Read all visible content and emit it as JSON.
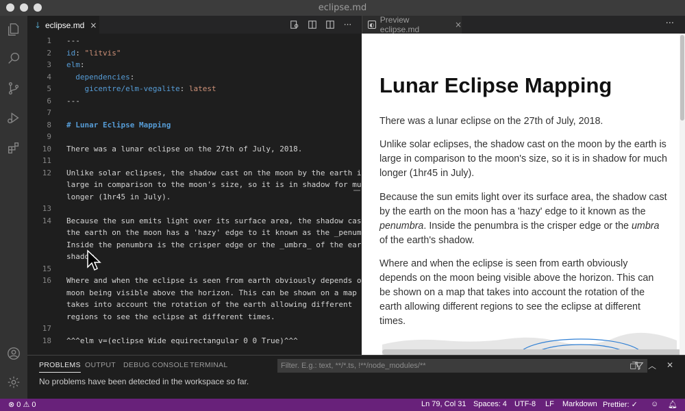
{
  "window": {
    "title": "eclipse.md"
  },
  "activity_bar": {
    "items": [
      "explorer-icon",
      "search-icon",
      "source-control-icon",
      "run-debug-icon",
      "extensions-icon"
    ],
    "bottom": [
      "account-icon",
      "settings-gear-icon"
    ]
  },
  "editor": {
    "tab_label": "eclipse.md",
    "tab_close": "×",
    "tab_icon": "↓",
    "lines": [
      {
        "n": "1",
        "text": "---"
      },
      {
        "n": "2",
        "key": "id",
        "sep": ": ",
        "value": "\"litvis\""
      },
      {
        "n": "3",
        "key": "elm",
        "sep": ":",
        "value": ""
      },
      {
        "n": "4",
        "indent": "  ",
        "key": "dependencies",
        "sep": ":",
        "value": ""
      },
      {
        "n": "5",
        "indent": "    ",
        "key": "gicentre/elm-vegalite",
        "sep": ": ",
        "value": "latest"
      },
      {
        "n": "6",
        "text": "---"
      },
      {
        "n": "7",
        "text": ""
      },
      {
        "n": "8",
        "heading": "# Lunar Eclipse Mapping"
      },
      {
        "n": "9",
        "text": ""
      },
      {
        "n": "10",
        "text": "There was a lunar eclipse on the 27th of July, 2018."
      },
      {
        "n": "11",
        "text": ""
      },
      {
        "n": "12",
        "text": "Unlike solar eclipses, the shadow cast on the moon by the earth is"
      },
      {
        "n": "",
        "text": "large in comparison to the moon's size, so it is in shadow for much"
      },
      {
        "n": "",
        "text": "longer (1hr45 in July)."
      },
      {
        "n": "13",
        "text": ""
      },
      {
        "n": "14",
        "text": "Because the sun emits light over its surface area, the shadow cast by"
      },
      {
        "n": "",
        "text": "the earth on the moon has a 'hazy' edge to it known as the _penumbra_."
      },
      {
        "n": "",
        "text": "Inside the penumbra is the crisper edge or the _umbra_ of the earth's"
      },
      {
        "n": "",
        "text": "shadow."
      },
      {
        "n": "15",
        "text": ""
      },
      {
        "n": "16",
        "text": "Where and when the eclipse is seen from earth obviously depends on the"
      },
      {
        "n": "",
        "text": "moon being visible above the horizon. This can be shown on a map that"
      },
      {
        "n": "",
        "text": "takes into account the rotation of the earth allowing different"
      },
      {
        "n": "",
        "text": "regions to see the eclipse at different times."
      },
      {
        "n": "17",
        "text": ""
      },
      {
        "n": "18",
        "text": "^^^elm v=(eclipse Wide equirectangular 0 0 True)^^^"
      }
    ],
    "toolbar_icons": [
      "open-preview-icon",
      "split-preview-icon",
      "split-editor-icon",
      "more-actions-icon"
    ]
  },
  "preview": {
    "tab_label": "Preview eclipse.md",
    "tab_close": "×",
    "more": "···",
    "heading": "Lunar Eclipse Mapping",
    "p1": "There was a lunar eclipse on the 27th of July, 2018.",
    "p2": "Unlike solar eclipses, the shadow cast on the moon by the earth is large in comparison to the moon's size, so it is in shadow for much longer (1hr45 in July).",
    "p3_a": "Because the sun emits light over its surface area, the shadow cast by the earth on the moon has a 'hazy' edge to it known as the ",
    "p3_em1": "penumbra",
    "p3_b": ". Inside the penumbra is the crisper edge or the ",
    "p3_em2": "umbra",
    "p3_c": " of the earth's shadow.",
    "p4": "Where and when the eclipse is seen from earth obviously depends on the moon being visible above the horizon. This can be shown on a map that takes into account the rotation of the earth allowing different regions to see the eclipse at different times."
  },
  "panel": {
    "tabs": [
      "PROBLEMS",
      "OUTPUT",
      "DEBUG CONSOLE",
      "TERMINAL"
    ],
    "filter_placeholder": "Filter. E.g.: text, **/*.ts, !**/node_modules/**",
    "message": "No problems have been detected in the workspace so far."
  },
  "statusbar": {
    "errors": "0",
    "warnings": "0",
    "position": "Ln 79, Col 31",
    "spaces": "Spaces: 4",
    "encoding": "UTF-8",
    "eol": "LF",
    "language": "Markdown",
    "prettier": "Prettier: ✓",
    "colors": {
      "background": "#68217a"
    }
  }
}
